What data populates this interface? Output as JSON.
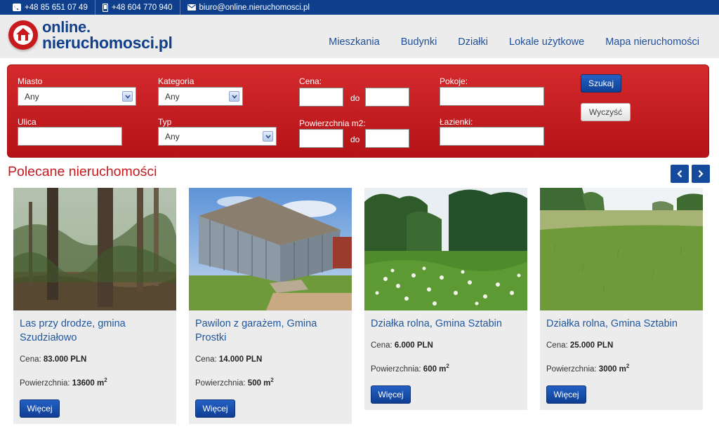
{
  "contact": {
    "phone1": "+48 85 651 07 49",
    "phone2": "+48 604 770 940",
    "email": "biuro@online.nieruchomosci.pl"
  },
  "logo": {
    "line1": "online.",
    "line2": "nieruchomosci.pl"
  },
  "nav": [
    "Mieszkania",
    "Budynki",
    "Działki",
    "Lokale użytkowe",
    "Mapa nieruchomości"
  ],
  "search": {
    "miasto_label": "Miasto",
    "miasto_value": "Any",
    "kategoria_label": "Kategoria",
    "kategoria_value": "Any",
    "cena_label": "Cena:",
    "do_label": "do",
    "pokoje_label": "Pokoje:",
    "ulica_label": "Ulica",
    "typ_label": "Typ",
    "typ_value": "Any",
    "powierzchnia_label": "Powierzchnia m2:",
    "lazienki_label": "Łazienki:",
    "szukaj_button": "Szukaj",
    "wyczysc_button": "Wyczyść"
  },
  "section_title": "Polecane nieruchomości",
  "cards": [
    {
      "title": "Las przy drodze, gmina Szudziałowo",
      "cena_label": "Cena:",
      "cena": "83.000 PLN",
      "pow_label": "Powierzchnia:",
      "pow": "13600 m",
      "more": "Więcej"
    },
    {
      "title": "Pawilon z garażem, Gmina Prostki",
      "cena_label": "Cena:",
      "cena": "14.000 PLN",
      "pow_label": "Powierzchnia:",
      "pow": "500 m",
      "more": "Więcej"
    },
    {
      "title": "Działka rolna, Gmina Sztabin",
      "cena_label": "Cena:",
      "cena": "6.000 PLN",
      "pow_label": "Powierzchnia:",
      "pow": "600 m",
      "more": "Więcej"
    },
    {
      "title": "Działka rolna, Gmina Sztabin",
      "cena_label": "Cena:",
      "cena": "25.000 PLN",
      "pow_label": "Powierzchnia:",
      "pow": "3000 m",
      "more": "Więcej"
    }
  ],
  "unit_sup": "2",
  "colors": {
    "brand_blue": "#0f3f8c",
    "brand_red": "#c8191c"
  },
  "icons": [
    "phone-icon",
    "mobile-icon",
    "envelope-icon",
    "chevron-left-icon",
    "chevron-right-icon",
    "dropdown-arrow-icon"
  ]
}
